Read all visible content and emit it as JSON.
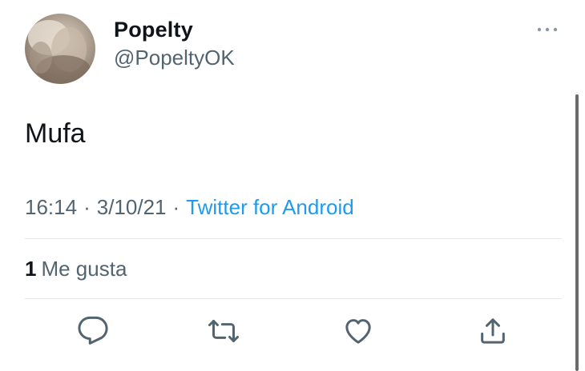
{
  "tweet": {
    "display_name": "Popelty",
    "handle": "@PopeltyOK",
    "text": "Mufa",
    "time": "16:14",
    "date": "3/10/21",
    "separator": "·",
    "source": "Twitter for Android",
    "likes_count": "1",
    "likes_label": "Me gusta"
  },
  "icons": {
    "more": "more-horizontal-icon",
    "reply": "reply-icon",
    "retweet": "retweet-icon",
    "like": "heart-icon",
    "share": "share-icon"
  },
  "colors": {
    "text": "#0f1419",
    "secondary": "#536471",
    "link": "#1d9bf0",
    "divider": "#e6e9ec"
  }
}
